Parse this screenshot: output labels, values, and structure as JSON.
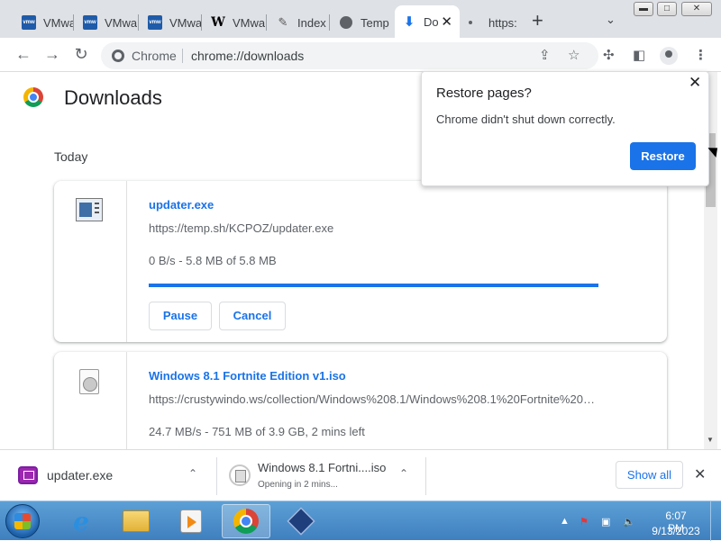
{
  "window_controls": {
    "minimize": "▬",
    "maximize": "□",
    "close": "✕"
  },
  "tabs": [
    {
      "label": "VMwa",
      "icon": "vmware-icon"
    },
    {
      "label": "VMwa",
      "icon": "vmware-icon"
    },
    {
      "label": "VMwa",
      "icon": "vmware-icon"
    },
    {
      "label": "VMwa",
      "icon": "wikipedia-icon"
    },
    {
      "label": "Index",
      "icon": "index-icon"
    },
    {
      "label": "Temp",
      "icon": "globe-icon"
    },
    {
      "label": "Do",
      "icon": "download-icon",
      "active": true,
      "close": "✕"
    },
    {
      "label": "https:",
      "icon": "loading-dot-icon"
    }
  ],
  "toolbar": {
    "site_label": "Chrome",
    "url": "chrome://downloads"
  },
  "page": {
    "title": "Downloads",
    "section_label": "Today"
  },
  "downloads": [
    {
      "name": "updater.exe",
      "url": "https://temp.sh/KCPOZ/updater.exe",
      "status": "0 B/s - 5.8 MB of 5.8 MB",
      "progress": 1.0,
      "pause_label": "Pause",
      "cancel_label": "Cancel"
    },
    {
      "name": "Windows 8.1 Fortnite Edition v1.iso",
      "url": "https://crustywindo.ws/collection/Windows%208.1/Windows%208.1%20Fortnite%20…",
      "status": "24.7 MB/s - 751 MB of 3.9 GB, 2 mins left"
    }
  ],
  "restore_popup": {
    "title": "Restore pages?",
    "message": "Chrome didn't shut down correctly.",
    "button": "Restore",
    "close": "✕"
  },
  "shelf": {
    "items": [
      {
        "name": "updater.exe"
      },
      {
        "name": "Windows 8.1 Fortni....iso",
        "status": "Opening in 2 mins..."
      }
    ],
    "show_all": "Show all",
    "close": "✕"
  },
  "taskbar": {
    "apps": [
      "internet-explorer-icon",
      "file-explorer-icon",
      "media-player-icon",
      "chrome-icon",
      "virtualbox-icon"
    ],
    "clock_time": "6:07 PM",
    "clock_date": "9/13/2023"
  },
  "colors": {
    "accent": "#1a73e8",
    "taskbar": "#3f7fbf"
  }
}
